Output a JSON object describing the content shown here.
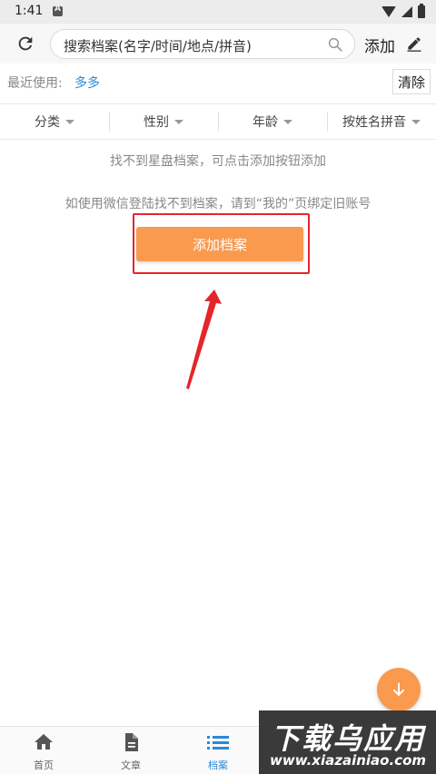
{
  "status_bar": {
    "time": "1:41"
  },
  "search": {
    "placeholder": "搜索档案(名字/时间/地点/拼音)",
    "add_label": "添加"
  },
  "recent": {
    "label": "最近使用:",
    "item": "多多",
    "clear_label": "清除"
  },
  "filters": [
    {
      "label": "分类"
    },
    {
      "label": "性别"
    },
    {
      "label": "年龄"
    },
    {
      "label": "按姓名拼音"
    }
  ],
  "empty": {
    "line1": "找不到星盘档案，可点击添加按钮添加",
    "line2": "如使用微信登陆找不到档案，请到“我的”页绑定旧账号",
    "add_button": "添加档案"
  },
  "bottom_nav": [
    {
      "label": "首页",
      "icon": "home-icon",
      "active": false
    },
    {
      "label": "文章",
      "icon": "document-icon",
      "active": false
    },
    {
      "label": "档案",
      "icon": "list-icon",
      "active": true
    }
  ],
  "watermark": {
    "title": "下载乌应用",
    "url": "www.xiazainiao.com"
  },
  "colors": {
    "accent": "#f99a4f",
    "link": "#2a8ad8",
    "highlight": "#e4262b"
  }
}
